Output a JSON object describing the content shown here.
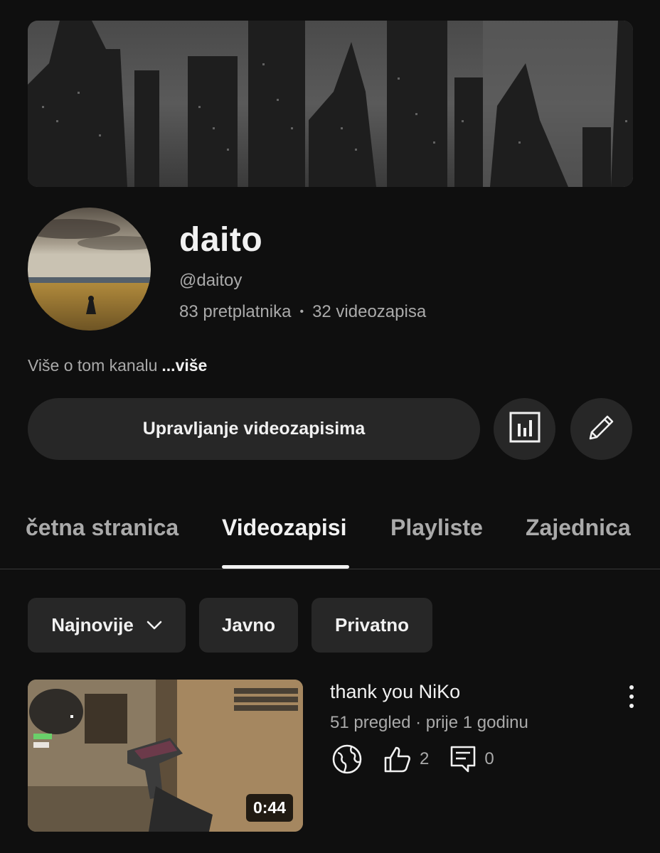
{
  "channel": {
    "name": "daito",
    "handle": "@daitoy",
    "subscribers": "83 pretplatnika",
    "stats_separator": "•",
    "videos_count": "32 videozapisa",
    "about_text": "Više o tom kanalu",
    "about_more": "...više"
  },
  "actions": {
    "manage_videos": "Upravljanje videozapisima",
    "analytics_icon": "analytics-icon",
    "edit_icon": "pencil-icon"
  },
  "tabs": [
    {
      "label": "četna stranica",
      "active": false
    },
    {
      "label": "Videozapisi",
      "active": true
    },
    {
      "label": "Playliste",
      "active": false
    },
    {
      "label": "Zajednica",
      "active": false
    }
  ],
  "filters": {
    "sort": "Najnovije",
    "public": "Javno",
    "private": "Privatno"
  },
  "video": {
    "title": "thank you NiKo",
    "meta": "51 pregled · prije 1 godinu",
    "duration": "0:44",
    "likes": "2",
    "comments": "0",
    "visibility_icon": "globe-icon"
  },
  "colors": {
    "background": "#0f0f0f",
    "surface": "#272727",
    "text_primary": "#f1f1f1",
    "text_secondary": "#aaaaaa"
  }
}
